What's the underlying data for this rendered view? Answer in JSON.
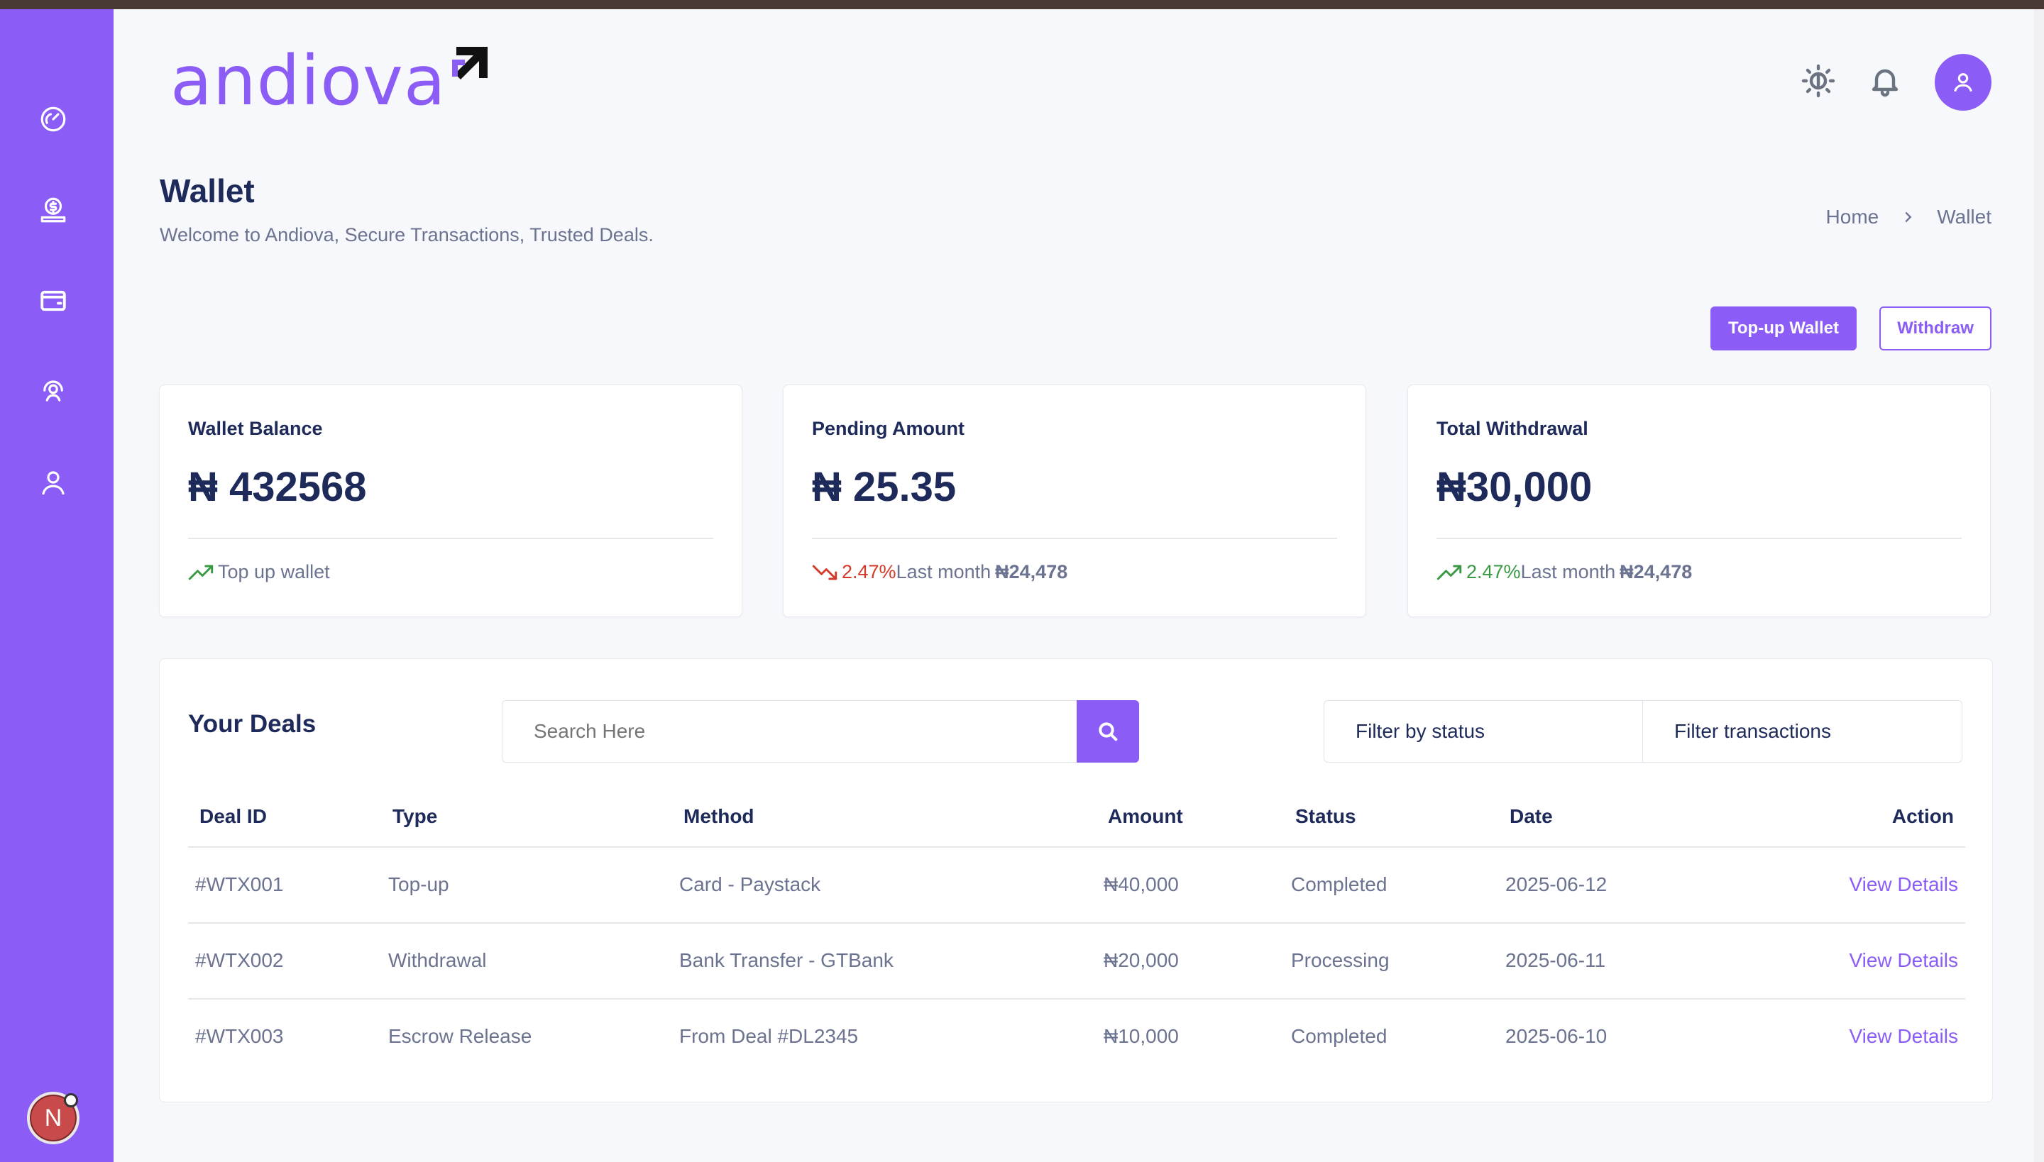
{
  "brand": {
    "name": "andiova",
    "accent": "#8b5cf6"
  },
  "sidebar": {
    "items": [
      {
        "name": "dashboard",
        "icon": "speedometer-icon"
      },
      {
        "name": "deals",
        "icon": "money-hand-icon"
      },
      {
        "name": "wallet",
        "icon": "wallet-icon",
        "active": true
      },
      {
        "name": "support",
        "icon": "support-person-icon"
      },
      {
        "name": "profile",
        "icon": "user-icon"
      }
    ],
    "badge_letter": "N"
  },
  "header": {
    "icons": [
      "theme-toggle-icon",
      "bell-icon",
      "user-avatar-icon"
    ]
  },
  "page": {
    "title": "Wallet",
    "subtitle": "Welcome to Andiova, Secure Transactions, Trusted Deals.",
    "breadcrumb": [
      "Home",
      "Wallet"
    ]
  },
  "actions": {
    "topup": "Top-up Wallet",
    "withdraw": "Withdraw"
  },
  "cards": [
    {
      "label": "Wallet Balance",
      "value": "₦ 432568",
      "foot_text": "Top up wallet",
      "trend": "up"
    },
    {
      "label": "Pending Amount",
      "value": "₦ 25.35",
      "foot_pct": "2.47%",
      "foot_text": "Last month",
      "foot_amount": "₦24,478",
      "trend": "down"
    },
    {
      "label": "Total Withdrawal",
      "value": "₦30,000",
      "foot_pct": "2.47%",
      "foot_text": "Last month",
      "foot_amount": "₦24,478",
      "trend": "up"
    }
  ],
  "deals": {
    "title": "Your Deals",
    "search_placeholder": "Search Here",
    "filter_status": "Filter by status",
    "filter_transactions": "Filter transactions",
    "columns": [
      "Deal ID",
      "Type",
      "Method",
      "Amount",
      "Status",
      "Date",
      "Action"
    ],
    "rows": [
      {
        "id": "#WTX001",
        "type": "Top-up",
        "method": "Card - Paystack",
        "amount": "₦40,000",
        "status": "Completed",
        "date": "2025-06-12",
        "action": "View Details"
      },
      {
        "id": "#WTX002",
        "type": "Withdrawal",
        "method": "Bank Transfer - GTBank",
        "amount": "₦20,000",
        "status": "Processing",
        "date": "2025-06-11",
        "action": "View Details"
      },
      {
        "id": "#WTX003",
        "type": "Escrow Release",
        "method": "From Deal #DL2345",
        "amount": "₦10,000",
        "status": "Completed",
        "date": "2025-06-10",
        "action": "View Details"
      }
    ]
  }
}
